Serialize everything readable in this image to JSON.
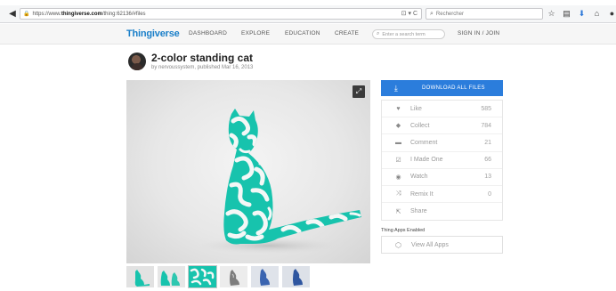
{
  "browser": {
    "url_prefix": "https://www.",
    "url_host": "thingiverse.com",
    "url_path": "/thing:62136/#files",
    "url_controls": "⊡ ▾ C",
    "search_placeholder": "Rechercher",
    "icons": [
      "star-icon",
      "clipboard-icon",
      "download-icon",
      "home-icon",
      "chat-icon"
    ]
  },
  "header": {
    "logo": "Thingiverse",
    "nav": [
      "DASHBOARD",
      "EXPLORE",
      "EDUCATION",
      "CREATE"
    ],
    "search_placeholder": "Enter a search term",
    "signin": "SIGN IN / JOIN"
  },
  "thing": {
    "title": "2-color standing cat",
    "byline": "by nervoussystem, published Mar 16, 2013"
  },
  "sidebar": {
    "download_label": "DOWNLOAD ALL FILES",
    "stats": [
      {
        "icon": "heart-icon",
        "glyph": "♥",
        "label": "Like",
        "count": "585"
      },
      {
        "icon": "collect-icon",
        "glyph": "◆",
        "label": "Collect",
        "count": "784"
      },
      {
        "icon": "comment-icon",
        "glyph": "▬",
        "label": "Comment",
        "count": "21"
      },
      {
        "icon": "made-one-icon",
        "glyph": "☑",
        "label": "I Made One",
        "count": "66"
      },
      {
        "icon": "eye-icon",
        "glyph": "◉",
        "label": "Watch",
        "count": "13"
      },
      {
        "icon": "remix-icon",
        "glyph": "⤨",
        "label": "Remix It",
        "count": "0"
      },
      {
        "icon": "share-icon",
        "glyph": "⇱",
        "label": "Share",
        "count": ""
      }
    ],
    "apps_label": "Thing Apps Enabled",
    "apps_button": "View All Apps"
  },
  "colors": {
    "accent": "#2b7ddc",
    "logo": "#1a7fc9",
    "cat_teal": "#17c3ad"
  },
  "thumbnails": [
    {
      "name": "thumb-cat-side",
      "selected": false
    },
    {
      "name": "thumb-cats-pair",
      "selected": false
    },
    {
      "name": "thumb-cat-pattern-closeup",
      "selected": true
    },
    {
      "name": "thumb-cat-grey",
      "selected": false
    },
    {
      "name": "thumb-cat-blue",
      "selected": false
    },
    {
      "name": "thumb-cat-blue-2",
      "selected": false
    }
  ]
}
